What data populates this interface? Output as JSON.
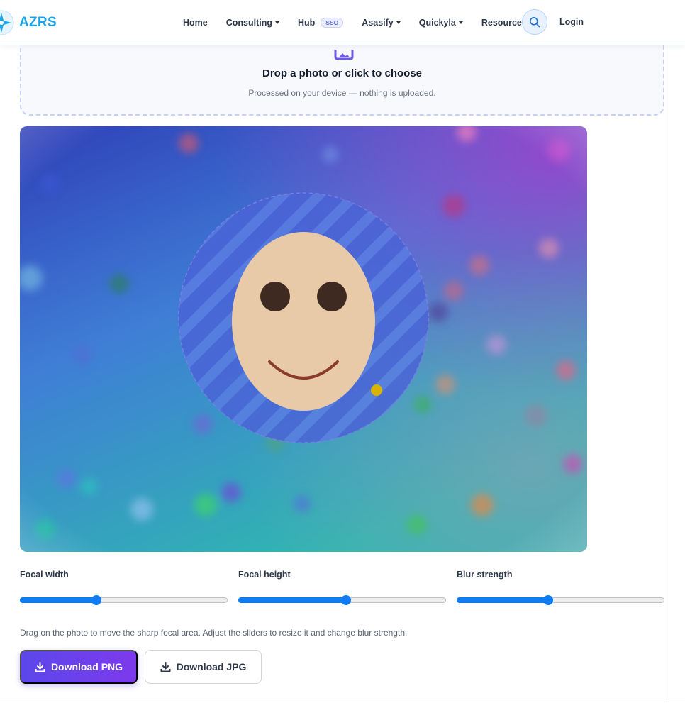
{
  "brand": {
    "name": "AZRS"
  },
  "nav": {
    "items": [
      {
        "label": "Home",
        "dropdown": false
      },
      {
        "label": "Consulting",
        "dropdown": true
      },
      {
        "label": "Hub",
        "dropdown": false,
        "badge": "SSO"
      },
      {
        "label": "Asasify",
        "dropdown": true
      },
      {
        "label": "Quickyla",
        "dropdown": true
      },
      {
        "label": "Resources",
        "dropdown": true
      }
    ],
    "login": "Login"
  },
  "dropzone": {
    "title": "Drop a photo or click to choose",
    "subtitle": "Processed on your device — nothing is uploaded."
  },
  "controls": {
    "focal_width": {
      "label": "Focal width",
      "value": 0.37
    },
    "focal_height": {
      "label": "Focal height",
      "value": 0.52
    },
    "blur_strength": {
      "label": "Blur strength",
      "value": 0.44
    }
  },
  "hint": "Drag on the photo to move the sharp focal area. Adjust the sliders to resize it and change blur strength.",
  "actions": {
    "download_png": "Download PNG",
    "download_jpg": "Download JPG"
  },
  "colors": {
    "accent": "#0f7cf2",
    "primary_button_start": "#5b47ea",
    "primary_button_end": "#7d3aed",
    "brand": "#1aa3e8",
    "face": "#e8c9a8",
    "eyes": "#3f2a21",
    "mouth": "#8a3b2e",
    "dot": "#d8b400"
  }
}
